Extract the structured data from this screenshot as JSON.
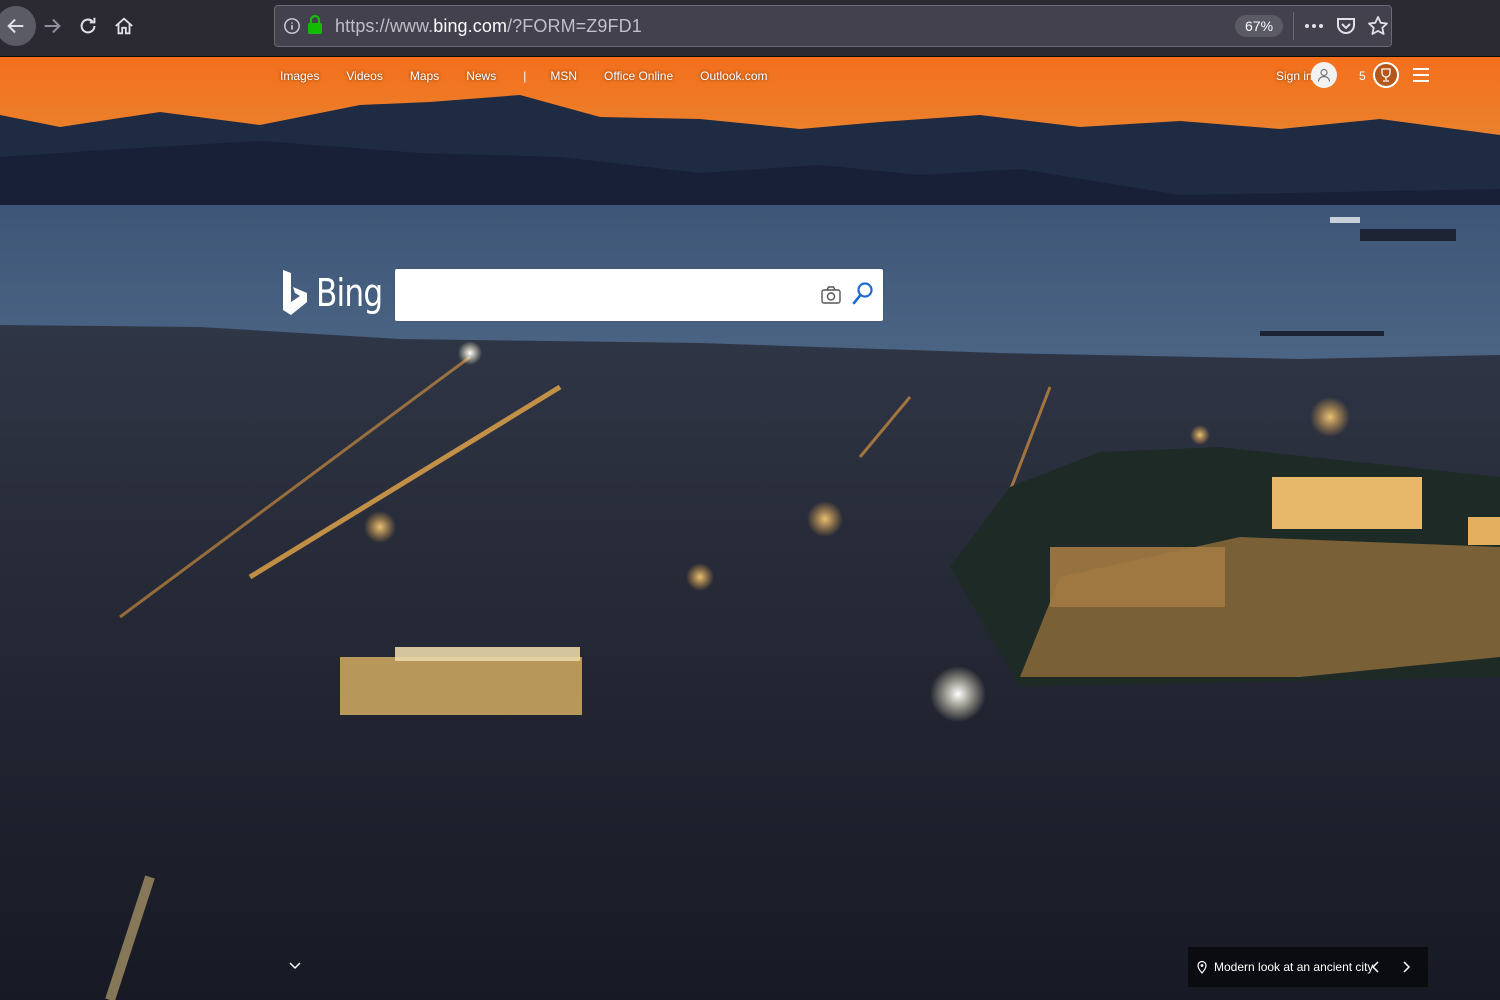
{
  "browser": {
    "url_prefix": "https://www.",
    "url_domain": "bing.com",
    "url_path": "/?FORM=Z9FD1",
    "zoom": "67%",
    "icons": [
      "back-arrow-icon",
      "forward-arrow-icon",
      "reload-icon",
      "home-icon",
      "info-icon",
      "lock-icon",
      "more-icon",
      "pocket-icon",
      "star-icon"
    ]
  },
  "bing": {
    "nav": [
      "Images",
      "Videos",
      "Maps",
      "News",
      "|",
      "MSN",
      "Office Online",
      "Outlook.com"
    ],
    "sign_in": "Sign in",
    "rewards_count": "5",
    "logo_text": "Bing",
    "search_value": "",
    "caption": "Modern look at an ancient city"
  },
  "colors": {
    "sky": "#f07a2a",
    "chrome": "#2b2a33",
    "search_accent": "#1f6bd1"
  }
}
